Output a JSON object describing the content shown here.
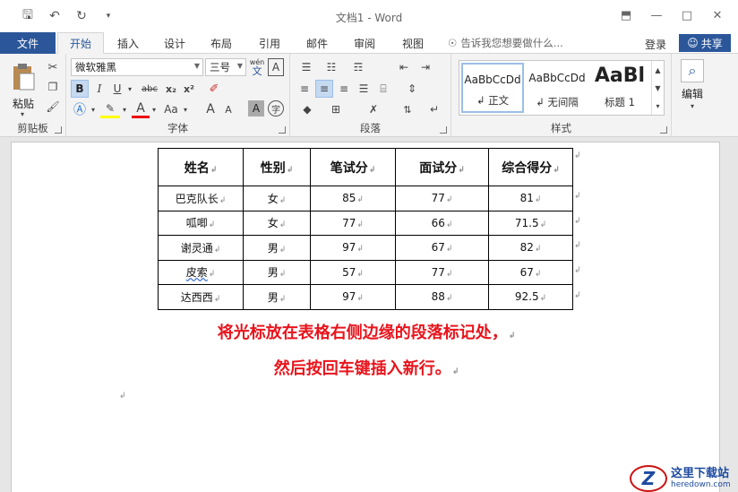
{
  "window": {
    "title": "文档1 - Word"
  },
  "tabs": {
    "file": "文件",
    "home": "开始",
    "insert": "插入",
    "design": "设计",
    "layout": "布局",
    "references": "引用",
    "mailings": "邮件",
    "review": "审阅",
    "view": "视图"
  },
  "tell_me": "告诉我您想要做什么...",
  "account": {
    "login": "登录",
    "share": "共享"
  },
  "ribbon": {
    "clipboard": {
      "paste": "粘贴",
      "label": "剪贴板"
    },
    "font": {
      "name": "微软雅黑",
      "size": "三号",
      "wen": "wén",
      "wen_char": "文",
      "bold": "B",
      "italic": "I",
      "underline": "U",
      "strike": "abc",
      "sub": "x₂",
      "sup": "x²",
      "case": "Aa",
      "grow": "A",
      "shrink": "A",
      "char_shade": "A",
      "enclose": "字",
      "label": "字体"
    },
    "paragraph": {
      "label": "段落"
    },
    "styles": {
      "sample1": "AaBbCcDd",
      "name1": "↲ 正文",
      "sample2": "AaBbCcDd",
      "name2": "↲ 无间隔",
      "sample3": "AaBl",
      "name3": "标题 1",
      "label": "样式"
    },
    "editing": {
      "label": "编辑"
    }
  },
  "table": {
    "headers": [
      "姓名",
      "性别",
      "笔试分",
      "面试分",
      "综合得分"
    ],
    "rows": [
      [
        "巴克队长",
        "女",
        "85",
        "77",
        "81"
      ],
      [
        "呱唧",
        "女",
        "77",
        "66",
        "71.5"
      ],
      [
        "谢灵通",
        "男",
        "97",
        "67",
        "82"
      ],
      [
        "皮索",
        "男",
        "57",
        "77",
        "67"
      ],
      [
        "达西西",
        "男",
        "97",
        "88",
        "92.5"
      ]
    ]
  },
  "note": {
    "line1": "将光标放在表格右侧边缘的段落标记处，",
    "line2": "然后按回车键插入新行。"
  },
  "watermark": {
    "name": "这里下载站",
    "url": "heredown.com",
    "logo_letter": "Z"
  },
  "colors": {
    "accent": "#2b579a",
    "note": "#e8141c"
  }
}
